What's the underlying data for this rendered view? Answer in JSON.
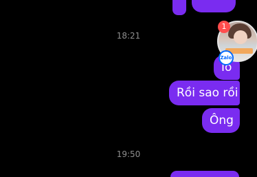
{
  "timestamps": [
    "18:21",
    "19:50"
  ],
  "messages": [
    {
      "text": "Iô"
    },
    {
      "text": "Rồi sao rồi"
    },
    {
      "text": "Ông"
    }
  ],
  "chathead": {
    "badge_count": "1",
    "app_label": "Zalo"
  },
  "colors": {
    "bubble": "#7a2cf0",
    "background": "#000000",
    "timestamp": "#8e8e8e"
  }
}
